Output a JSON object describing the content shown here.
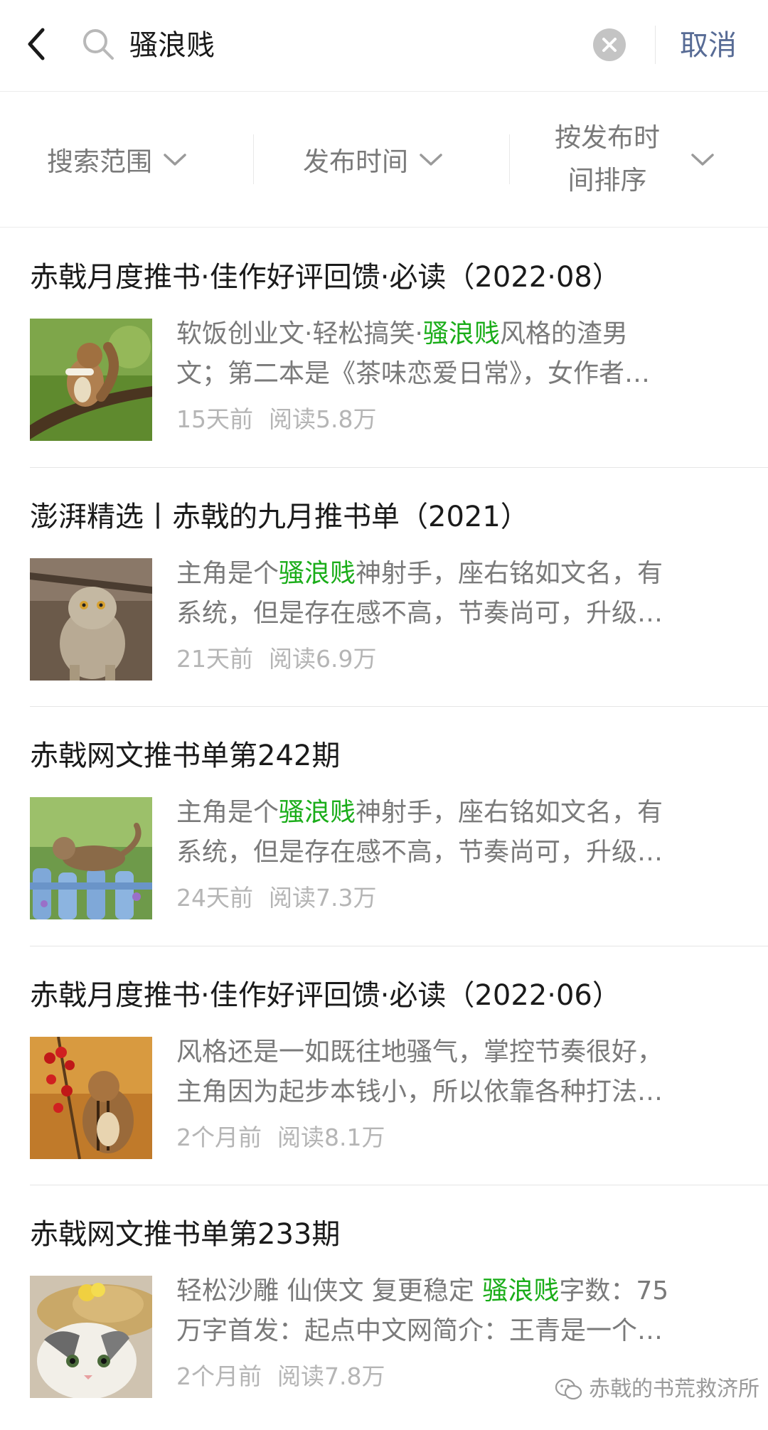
{
  "search": {
    "query": "骚浪贱",
    "cancel_label": "取消"
  },
  "filters": [
    {
      "label": "搜索范围"
    },
    {
      "label": "发布时间"
    },
    {
      "label_line1": "按发布时",
      "label_line2": "间排序"
    }
  ],
  "results": [
    {
      "title": "赤戟月度推书·佳作好评回馈·必读（2022·08）",
      "line1_pre": "软饭创业文·轻松搞笑·",
      "line1_hl": "骚浪贱",
      "line1_post": "风格的渣男",
      "line2": "文；第二本是《茶味恋爱日常》，女作者…",
      "time": "15天前",
      "reads": "阅读5.8万"
    },
    {
      "title": "澎湃精选丨赤戟的九月推书单（2021）",
      "line1_pre": "主角是个",
      "line1_hl": "骚浪贱",
      "line1_post": "神射手，座右铭如文名，有",
      "line2": "系统，但是存在感不高，节奏尚可，升级…",
      "time": "21天前",
      "reads": "阅读6.9万"
    },
    {
      "title": "赤戟网文推书单第242期",
      "line1_pre": "主角是个",
      "line1_hl": "骚浪贱",
      "line1_post": "神射手，座右铭如文名，有",
      "line2": "系统，但是存在感不高，节奏尚可，升级…",
      "time": "24天前",
      "reads": "阅读7.3万"
    },
    {
      "title": "赤戟月度推书·佳作好评回馈·必读（2022·06）",
      "line1_pre": "风格还是一如既往地骚气，掌控节奏很好，",
      "line1_hl": "",
      "line1_post": "",
      "line2": "主角因为起步本钱小，所以依靠各种打法…",
      "time": "2个月前",
      "reads": "阅读8.1万"
    },
    {
      "title": "赤戟网文推书单第233期",
      "line1_pre": "轻松沙雕 仙侠文 复更稳定 ",
      "line1_hl": "骚浪贱",
      "line1_post": "字数：75",
      "line2": "万字首发：起点中文网简介：王青是一个…",
      "time": "2个月前",
      "reads": "阅读7.8万"
    }
  ],
  "watermark": "赤戟的书荒救济所",
  "colors": {
    "accent_link": "#576b95",
    "highlight": "#1aad19",
    "meta": "#b5b5b5"
  }
}
